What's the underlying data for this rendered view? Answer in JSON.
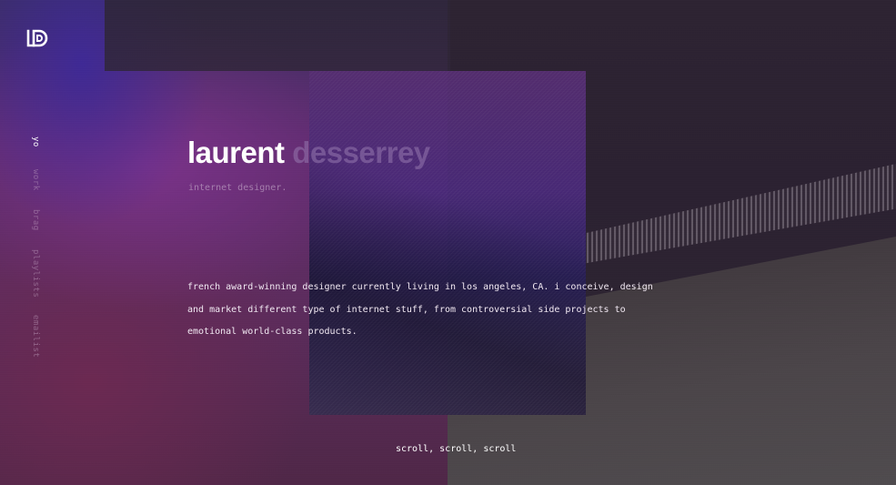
{
  "brand": {
    "logo_icon": "ld-monogram-icon"
  },
  "nav": {
    "items": [
      {
        "label": "yo",
        "active": true
      },
      {
        "label": "work",
        "active": false
      },
      {
        "label": "brag",
        "active": false
      },
      {
        "label": "playlists",
        "active": false
      },
      {
        "label": "emailist",
        "active": false
      }
    ]
  },
  "hero": {
    "first_name": "laurent",
    "last_name": "desserrey",
    "tagline": "internet designer.",
    "bio": "french award-winning designer currently living in los angeles, CA. i conceive, design and market different type of internet stuff, from controversial side projects to emotional world-class products."
  },
  "footer": {
    "scroll_label": "scroll, scroll, scroll"
  },
  "colors": {
    "accent_purple": "#5b2a6a",
    "text_white": "#ffffff",
    "muted_lavender": "#967aaf"
  }
}
